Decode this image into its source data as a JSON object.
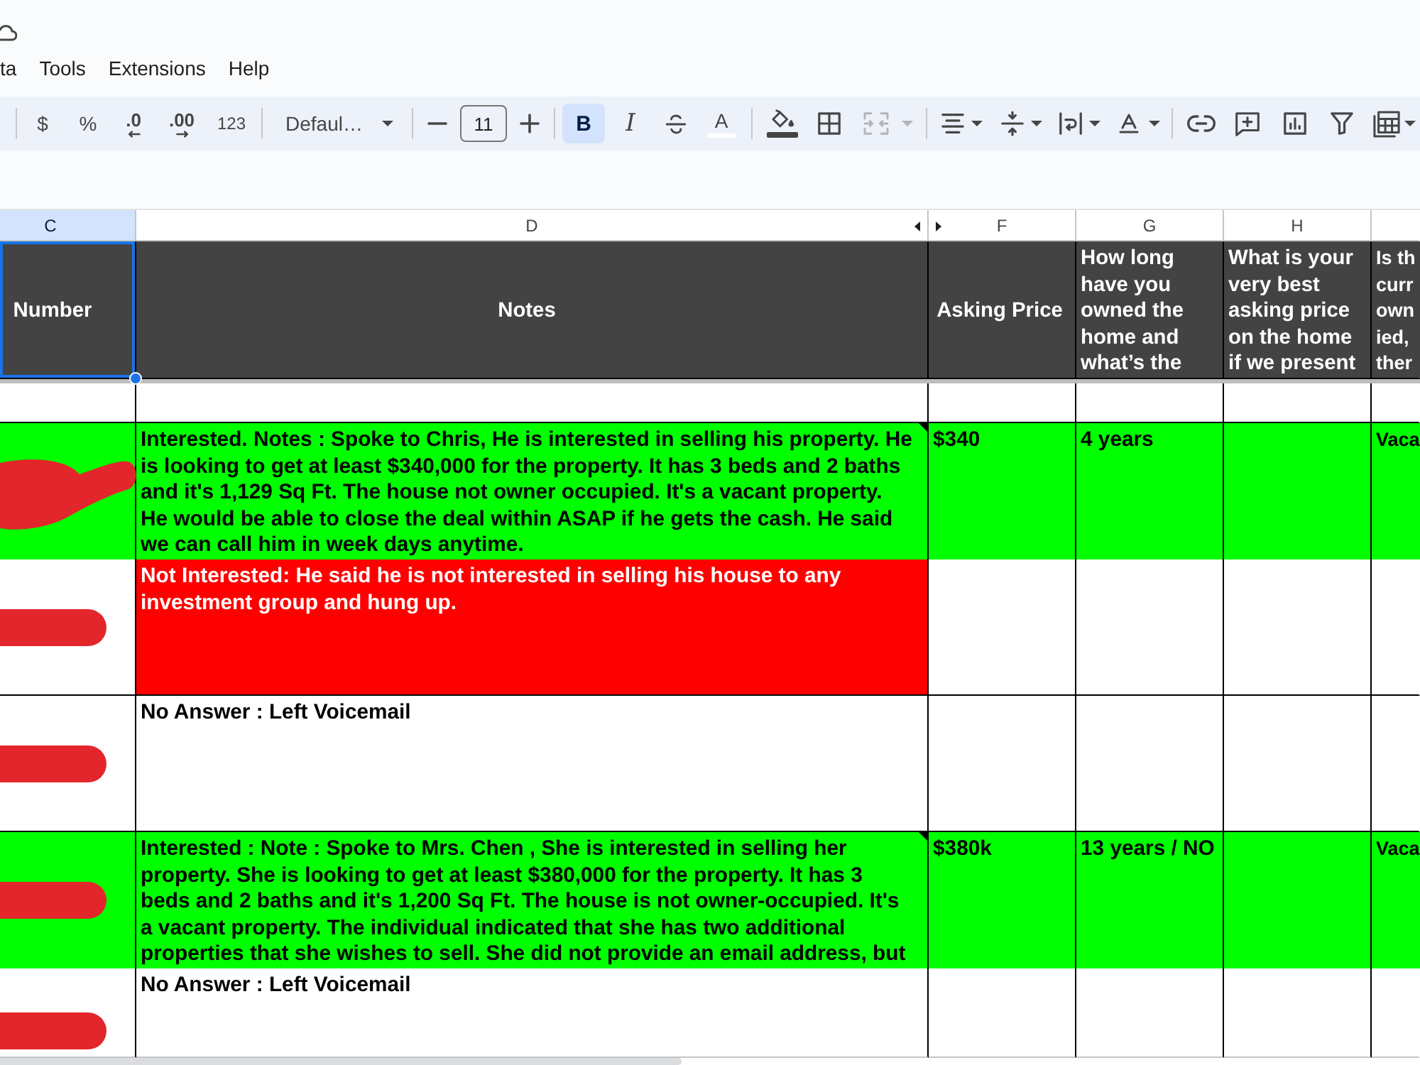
{
  "topbar": {
    "menu": [
      "ta",
      "Tools",
      "Extensions",
      "Help"
    ]
  },
  "toolbar": {
    "format_buttons": [
      {
        "kind": "plain",
        "label": "$"
      },
      {
        "kind": "plain",
        "label": "%"
      },
      {
        "kind": "decrease_decimal",
        "label": ".0"
      },
      {
        "kind": "increase_decimal",
        "label": ".00"
      },
      {
        "kind": "plain",
        "label": "123"
      }
    ],
    "font": "Defaul…",
    "font_size": "11",
    "style_buttons": [
      {
        "kind": "bold",
        "label": "B",
        "selected": true
      },
      {
        "kind": "italic",
        "label": "I",
        "selected": false
      }
    ],
    "text_color": {
      "label": "A",
      "color": "#ffffff"
    },
    "fill_color": {
      "color": "#434343"
    },
    "merge_disabled": true
  },
  "sheet": {
    "columns": [
      {
        "letter": "C",
        "selected": true,
        "hidden_after": false
      },
      {
        "letter": "D",
        "selected": false,
        "hidden_after": true
      },
      {
        "letter": "F",
        "selected": false,
        "hidden_after": false
      },
      {
        "letter": "G",
        "selected": false,
        "hidden_after": false
      },
      {
        "letter": "H",
        "selected": false,
        "hidden_after": false
      },
      {
        "selected": false,
        "hidden_after": false
      }
    ],
    "rows": [
      {
        "kind": "header",
        "cells": [
          {
            "text": "Number",
            "color": "#434343",
            "centered": true,
            "selected": true,
            "note": false
          },
          {
            "text": "Notes",
            "color": "#434343",
            "centered": true,
            "selected": false,
            "note": false
          },
          {
            "text": "Asking Price",
            "color": "#434343",
            "centered": true,
            "selected": false,
            "note": false
          },
          {
            "text": "How long have you owned the home and what’s the",
            "color": "#434343",
            "centered": false,
            "selected": false,
            "note": false
          },
          {
            "text": "What is your very best asking price on the home if we present",
            "color": "#434343",
            "centered": false,
            "selected": false,
            "note": false
          },
          {
            "text": "Is th\ncurr\nown\nied,\nther",
            "color": "#434343",
            "centered": false,
            "selected": false,
            "note": false
          }
        ]
      },
      {
        "kind": "empty",
        "cells": [
          {
            "color": "#ffffff",
            "selected": false,
            "note": false
          },
          {
            "color": "#ffffff",
            "selected": false,
            "note": false
          },
          {
            "color": "#ffffff",
            "selected": false,
            "note": false
          },
          {
            "color": "#ffffff",
            "selected": false,
            "note": false
          },
          {
            "color": "#ffffff",
            "selected": false,
            "note": false
          },
          {
            "color": "#ffffff",
            "selected": false,
            "note": false
          }
        ]
      },
      {
        "kind": "data",
        "redaction": {
          "kind": "swoosh"
        },
        "cells": [
          {
            "color": "#00ff00",
            "selected": false,
            "note": false
          },
          {
            "text": "Interested. Notes : Spoke to Chris, He is interested in selling his property. He is looking to get at least $340,000 for the property. It has 3 beds and 2 baths and it's 1,129 Sq Ft. The house not owner occupied. It's a vacant property. He would be able to close the deal within ASAP if he gets the cash. He said we can call him in week days anytime.",
            "color": "#00ff00",
            "centered": false,
            "selected": false,
            "note": true
          },
          {
            "text": "$340",
            "color": "#00ff00",
            "centered": false,
            "selected": false,
            "note": false
          },
          {
            "text": "4 years",
            "color": "#00ff00",
            "centered": false,
            "selected": false,
            "note": false
          },
          {
            "color": "#00ff00",
            "selected": false,
            "note": false
          },
          {
            "text": "Vaca",
            "color": "#00ff00",
            "centered": false,
            "selected": false,
            "note": false
          }
        ]
      },
      {
        "kind": "data",
        "redaction": {
          "kind": "bar"
        },
        "cells": [
          {
            "color": "#ffffff",
            "selected": false,
            "note": false
          },
          {
            "text": "Not Interested: He said he is not interested in selling his house to any investment group and hung up.",
            "color": "#ff0000",
            "centered": false,
            "selected": false,
            "note": false
          },
          {
            "color": "#ffffff",
            "selected": false,
            "note": false
          },
          {
            "color": "#ffffff",
            "selected": false,
            "note": false
          },
          {
            "color": "#ffffff",
            "selected": false,
            "note": false
          },
          {
            "color": "#ffffff",
            "selected": false,
            "note": false
          }
        ]
      },
      {
        "kind": "data",
        "redaction": {
          "kind": "bar"
        },
        "cells": [
          {
            "color": "#ffffff",
            "selected": false,
            "note": false
          },
          {
            "text": "No Answer : Left Voicemail",
            "color": "#ffffff",
            "centered": false,
            "selected": false,
            "note": false
          },
          {
            "color": "#ffffff",
            "selected": false,
            "note": false
          },
          {
            "color": "#ffffff",
            "selected": false,
            "note": false
          },
          {
            "color": "#ffffff",
            "selected": false,
            "note": false
          },
          {
            "color": "#ffffff",
            "selected": false,
            "note": false
          }
        ]
      },
      {
        "kind": "data",
        "redaction": {
          "kind": "bar"
        },
        "cells": [
          {
            "color": "#00ff00",
            "selected": false,
            "note": false
          },
          {
            "text": "Interested : Note : Spoke to Mrs. Chen , She is interested in selling her property. She is looking to get at least $380,000 for the property. It has 3 beds and 2 baths and it's 1,200 Sq Ft. The house is not owner-occupied. It's a vacant property. The individual indicated that she has two additional properties that she wishes to sell. She did not provide an email address, but",
            "color": "#00ff00",
            "centered": false,
            "selected": false,
            "note": true
          },
          {
            "text": "$380k",
            "color": "#00ff00",
            "centered": false,
            "selected": false,
            "note": false
          },
          {
            "text": "13 years / NO",
            "color": "#00ff00",
            "centered": false,
            "selected": false,
            "note": false
          },
          {
            "color": "#00ff00",
            "selected": false,
            "note": false
          },
          {
            "text": "Vaca",
            "color": "#00ff00",
            "centered": false,
            "selected": false,
            "note": false
          }
        ]
      },
      {
        "kind": "data",
        "redaction": {
          "kind": "bar"
        },
        "cells": [
          {
            "color": "#ffffff",
            "selected": false,
            "note": false
          },
          {
            "text": "No Answer : Left Voicemail",
            "color": "#ffffff",
            "centered": false,
            "selected": false,
            "note": false
          },
          {
            "color": "#ffffff",
            "selected": false,
            "note": false
          },
          {
            "color": "#ffffff",
            "selected": false,
            "note": false
          },
          {
            "color": "#ffffff",
            "selected": false,
            "note": false
          },
          {
            "color": "#ffffff",
            "selected": false,
            "note": false
          }
        ]
      }
    ]
  }
}
